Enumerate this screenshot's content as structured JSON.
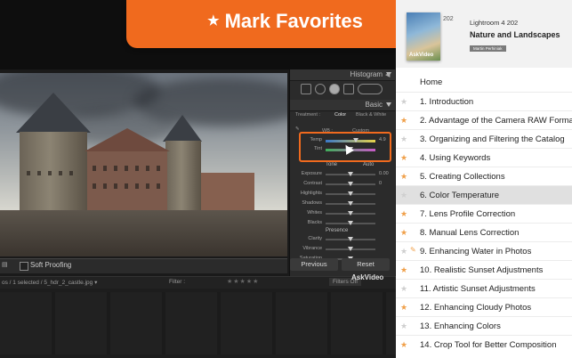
{
  "banner": {
    "star": "★",
    "title": "Mark Favorites"
  },
  "course": {
    "number": "202",
    "subtitle": "Lightroom 4 202",
    "title": "Nature and Landscapes",
    "author": "Martin Perhiniak",
    "thumb_brand": "AskVideo"
  },
  "lightroom": {
    "histogram": "Histogram",
    "basic": "Basic",
    "treatment_label": "Treatment :",
    "treatment_color": "Color",
    "treatment_bw": "Black & White",
    "wb_label": "WB :",
    "wb_value": "Custom",
    "sliders_wb": [
      {
        "label": "Temp",
        "value": "4.9",
        "pos": 0.6
      },
      {
        "label": "Tint",
        "value": "",
        "pos": 0.5
      }
    ],
    "tone_label": "Tone",
    "auto_label": "Auto",
    "sliders_tone": [
      {
        "label": "Exposure",
        "value": "0.00",
        "pos": 0.5
      },
      {
        "label": "Contrast",
        "value": "0",
        "pos": 0.5
      },
      {
        "label": "Highlights",
        "value": "",
        "pos": 0.5
      },
      {
        "label": "Shadows",
        "value": "",
        "pos": 0.5
      },
      {
        "label": "Whites",
        "value": "",
        "pos": 0.5
      },
      {
        "label": "Blacks",
        "value": "",
        "pos": 0.5
      }
    ],
    "presence_label": "Presence",
    "sliders_presence": [
      {
        "label": "Clarity",
        "value": "",
        "pos": 0.5
      },
      {
        "label": "Vibrance",
        "value": "",
        "pos": 0.5
      },
      {
        "label": "Saturation",
        "value": "",
        "pos": 0.5
      }
    ],
    "soft_proofing": "Soft Proofing",
    "previous": "Previous",
    "reset": "Reset",
    "status": "os / 1 selected / 5_hdr_2_castle.jpg ▾",
    "filter_label": "Filter :",
    "stars": "★★★★★",
    "filters_off": "Filters Off",
    "watermark": "AskVideo"
  },
  "toc": {
    "home": "Home",
    "items": [
      {
        "label": "1. Introduction",
        "favorite": false
      },
      {
        "label": "2. Advantage of the Camera RAW Format",
        "favorite": true
      },
      {
        "label": "3. Organizing and Filtering the Catalog",
        "favorite": false
      },
      {
        "label": "4. Using Keywords",
        "favorite": true
      },
      {
        "label": "5. Creating Collections",
        "favorite": true
      },
      {
        "label": "6. Color Temperature",
        "favorite": false,
        "selected": true
      },
      {
        "label": "7. Lens Profile Correction",
        "favorite": true
      },
      {
        "label": "8. Manual Lens Correction",
        "favorite": true
      },
      {
        "label": "9. Enhancing Water in Photos",
        "favorite": false,
        "editing": true
      },
      {
        "label": "10. Realistic Sunset Adjustments",
        "favorite": true
      },
      {
        "label": "11. Artistic Sunset Adjustments",
        "favorite": false
      },
      {
        "label": "12. Enhancing Cloudy Photos",
        "favorite": true
      },
      {
        "label": "13. Enhancing Colors",
        "favorite": false
      },
      {
        "label": "14. Crop Tool for Better Composition",
        "favorite": true
      }
    ]
  },
  "colors": {
    "accent": "#f06a1e",
    "star_on": "#f0a04a",
    "star_off": "#cfcfcf"
  }
}
